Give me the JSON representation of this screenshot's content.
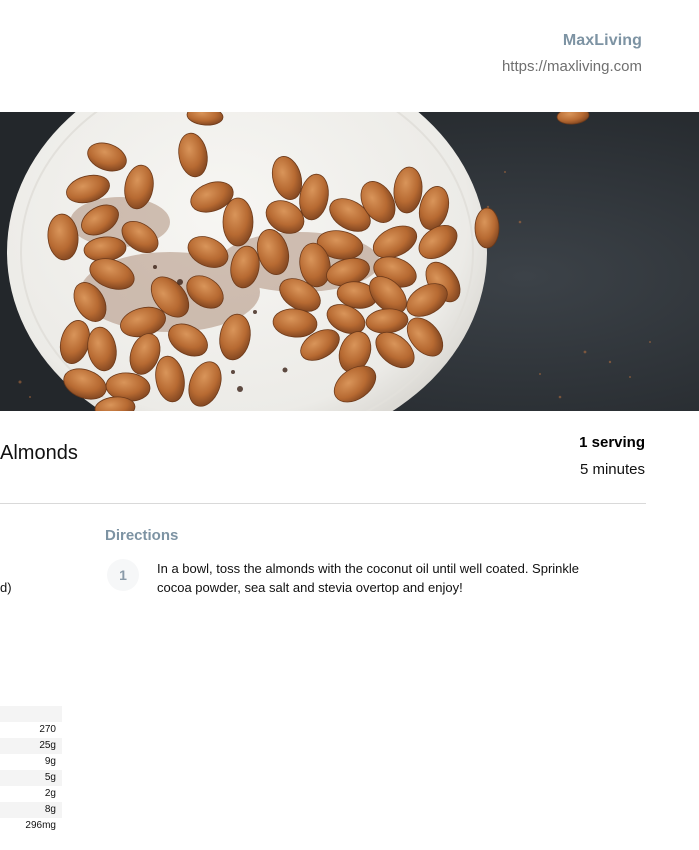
{
  "header": {
    "brand_name": "MaxLiving",
    "brand_url": "https://maxliving.com"
  },
  "recipe": {
    "title": "Almonds",
    "servings": "1 serving",
    "time": "5 minutes"
  },
  "ingredients": {
    "visible_fragment": "d)"
  },
  "directions": {
    "heading": "Directions",
    "steps": [
      {
        "number": "1",
        "text": "In a bowl, toss the almonds with the coconut oil until well coated. Sprinkle cocoa powder, sea salt and stevia overtop and enjoy!"
      }
    ]
  },
  "nutrition": {
    "values": [
      "270",
      "25g",
      "9g",
      "5g",
      "2g",
      "8g",
      "296mg"
    ]
  },
  "colors": {
    "accent": "#7d93a3",
    "background": "#ffffff",
    "text": "#111111"
  }
}
